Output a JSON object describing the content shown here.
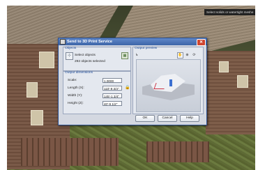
{
  "status_hint": "Select solids or watertight meshe",
  "dialog": {
    "title": "Send to 3D Print Service",
    "objects": {
      "group_label": "Objects",
      "select_label": "Select objects",
      "count_text": "292 objects selected"
    },
    "dimensions": {
      "group_label": "Output dimensions",
      "rows": [
        {
          "label": "Scale:",
          "value": "1.0000"
        },
        {
          "label": "Length (X):",
          "value": "110'-9 3/4\""
        },
        {
          "label": "Width (Y):",
          "value": "145'-1 3/4\""
        },
        {
          "label": "Height (Z):",
          "value": "40'-9 1/2\""
        }
      ]
    },
    "preview": {
      "group_label": "Output preview"
    },
    "buttons": {
      "ok": "OK",
      "cancel": "Cancel",
      "help": "Help"
    }
  },
  "colors": {
    "title_bar": "#3d65a8",
    "dialog_bg": "#d4d8e1",
    "close_button": "#d0452f",
    "group_label": "#1f4c99"
  },
  "icons": {
    "select_button": "cursor-select-icon",
    "quick_select": "quick-select-icon",
    "lock": "lock-icon",
    "preview_tools": [
      "axis-icon",
      "pan-hand-icon",
      "zoom-icon",
      "orbit-icon"
    ]
  }
}
